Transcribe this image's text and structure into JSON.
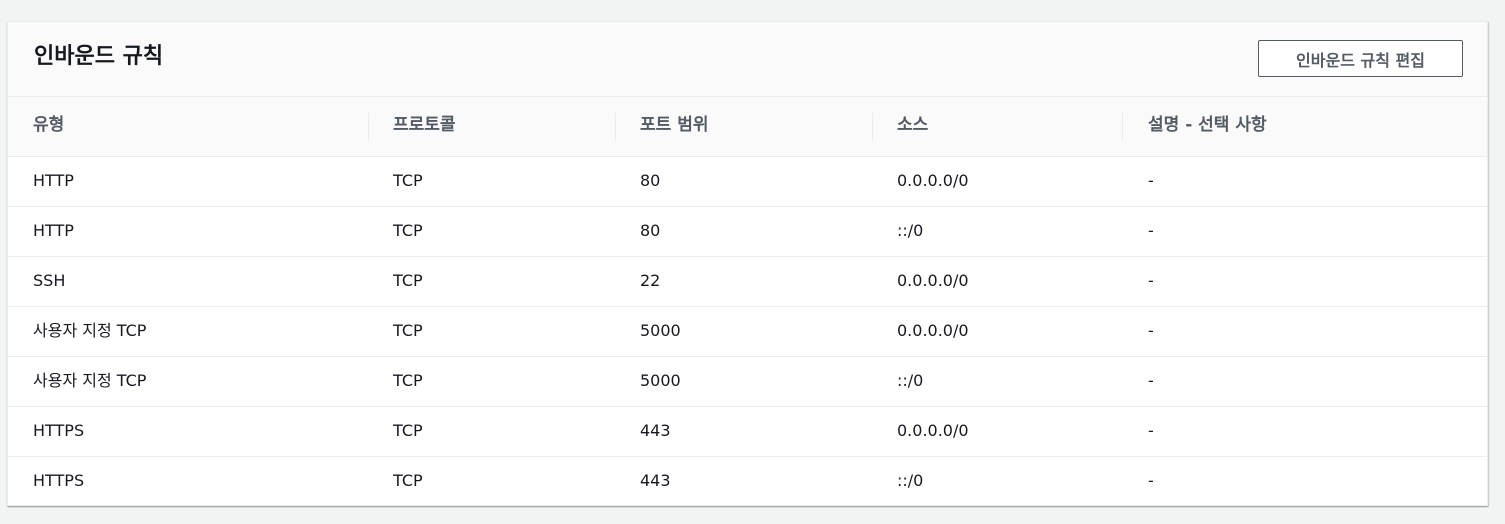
{
  "panel": {
    "title": "인바운드 규칙",
    "edit_button_label": "인바운드 규칙 편집"
  },
  "table": {
    "columns": [
      "유형",
      "프로토콜",
      "포트 범위",
      "소스",
      "설명 - 선택 사항"
    ],
    "rows": [
      [
        "HTTP",
        "TCP",
        "80",
        "0.0.0.0/0",
        "-"
      ],
      [
        "HTTP",
        "TCP",
        "80",
        "::/0",
        "-"
      ],
      [
        "SSH",
        "TCP",
        "22",
        "0.0.0.0/0",
        "-"
      ],
      [
        "사용자 지정 TCP",
        "TCP",
        "5000",
        "0.0.0.0/0",
        "-"
      ],
      [
        "사용자 지정 TCP",
        "TCP",
        "5000",
        "::/0",
        "-"
      ],
      [
        "HTTPS",
        "TCP",
        "443",
        "0.0.0.0/0",
        "-"
      ],
      [
        "HTTPS",
        "TCP",
        "443",
        "::/0",
        "-"
      ]
    ]
  }
}
